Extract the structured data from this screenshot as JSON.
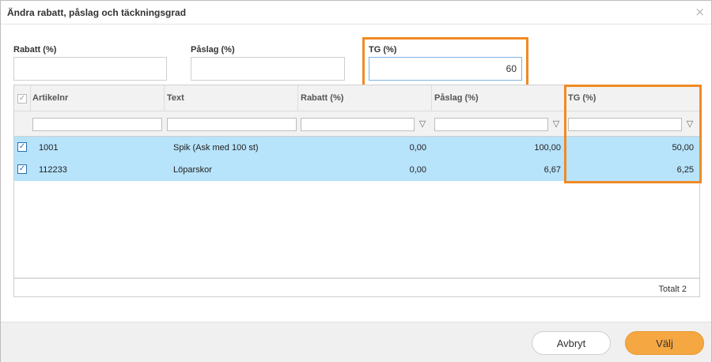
{
  "dialog": {
    "title": "Ändra rabatt, påslag och täckningsgrad",
    "close_glyph": "×"
  },
  "fields": {
    "rabatt": {
      "label": "Rabatt (%)",
      "value": ""
    },
    "paslag": {
      "label": "Påslag (%)",
      "value": ""
    },
    "tg": {
      "label": "TG (%)",
      "value": "60"
    }
  },
  "grid": {
    "columns": [
      "Artikelnr",
      "Text",
      "Rabatt (%)",
      "Påslag (%)",
      "TG (%)"
    ],
    "rows": [
      {
        "selected": true,
        "artikelnr": "1001",
        "text": "Spik (Ask med 100 st)",
        "rabatt": "0,00",
        "paslag": "100,00",
        "tg": "50,00"
      },
      {
        "selected": true,
        "artikelnr": "112233",
        "text": "Löparskor",
        "rabatt": "0,00",
        "paslag": "6,67",
        "tg": "6,25"
      }
    ],
    "total_label": "Totalt 2"
  },
  "buttons": {
    "cancel": "Avbryt",
    "ok": "Välj"
  },
  "colors": {
    "highlight": "#f08a24",
    "selected_row": "#b7e3fb",
    "primary_button": "#f5a742"
  },
  "icons": {
    "close": "close-icon",
    "filter": "filter-icon",
    "checkbox": "checkbox-checked-icon"
  }
}
